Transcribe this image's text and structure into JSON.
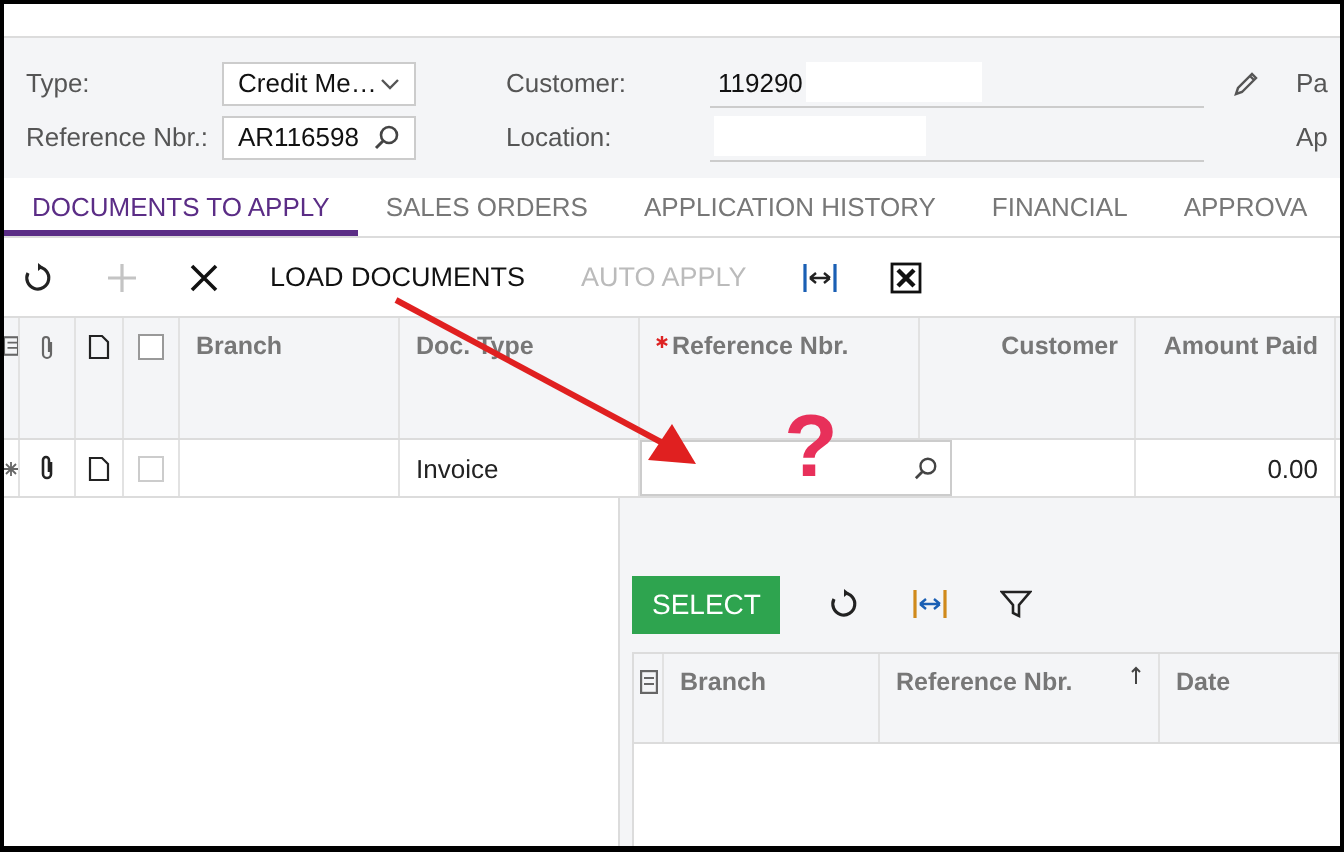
{
  "form": {
    "type": {
      "label": "Type:",
      "value": "Credit Me…"
    },
    "reference_nbr": {
      "label": "Reference Nbr.:",
      "value": "AR116598"
    },
    "customer": {
      "label": "Customer:",
      "value": "119290"
    },
    "location": {
      "label": "Location:"
    },
    "cut_labels": [
      "Pa",
      "Ap"
    ]
  },
  "tabs": [
    {
      "label": "DOCUMENTS TO APPLY",
      "selected": true
    },
    {
      "label": "SALES ORDERS",
      "selected": false
    },
    {
      "label": "APPLICATION HISTORY",
      "selected": false
    },
    {
      "label": "FINANCIAL",
      "selected": false
    },
    {
      "label": "APPROVA",
      "selected": false
    }
  ],
  "toolbar": [
    {
      "kind": "refresh",
      "disabled": false
    },
    {
      "kind": "add",
      "disabled": true
    },
    {
      "kind": "delete",
      "disabled": false
    },
    {
      "kind": "text",
      "label": "LOAD DOCUMENTS",
      "disabled": false
    },
    {
      "kind": "text",
      "label": "AUTO APPLY",
      "disabled": true
    },
    {
      "kind": "fit",
      "disabled": false
    },
    {
      "kind": "excel",
      "disabled": false
    }
  ],
  "grid": {
    "select_all_checked": false,
    "columns": [
      {
        "label": "Branch",
        "required": false
      },
      {
        "label": "Doc. Type",
        "required": false
      },
      {
        "label": "Reference Nbr.",
        "required": true
      },
      {
        "label": "Customer",
        "required": false
      },
      {
        "label": "Amount Paid",
        "required": false
      }
    ],
    "rows": [
      {
        "checked": false,
        "doc_type": "Invoice",
        "amount_paid": "0.00"
      }
    ]
  },
  "sub_panel": {
    "toolbar": [
      {
        "kind": "primary",
        "label": "SELECT"
      },
      {
        "kind": "refresh"
      },
      {
        "kind": "fit"
      },
      {
        "kind": "filter"
      }
    ],
    "columns": [
      {
        "label": "Branch",
        "sorted": false
      },
      {
        "label": "Reference Nbr.",
        "sorted": true
      },
      {
        "label": "Date",
        "sorted": false
      }
    ]
  },
  "annotation": {
    "mark": "?"
  }
}
